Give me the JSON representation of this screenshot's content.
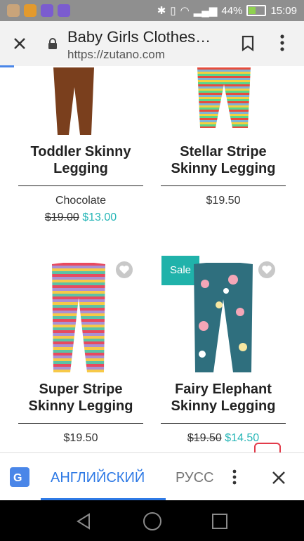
{
  "status_bar": {
    "battery": "44%",
    "time": "15:09",
    "battery_level": 0.44
  },
  "browser": {
    "title": "Baby Girls Clothes…",
    "url": "https://zutano.com",
    "icons": [
      "close-icon",
      "lock-icon",
      "bookmark-icon",
      "more-vert-icon"
    ]
  },
  "products": [
    {
      "name_line1": "Toddler Skinny",
      "name_line2": "Legging",
      "variant": "Chocolate",
      "old_price": "$19.00",
      "price": "$13.00"
    },
    {
      "name_line1": "Stellar Stripe",
      "name_line2": "Skinny Legging",
      "price": "$19.50"
    },
    {
      "name_line1": "Super Stripe",
      "name_line2": "Skinny Legging",
      "price": "$19.50"
    },
    {
      "badge": "Sale",
      "name_line1": "Fairy Elephant",
      "name_line2": "Skinny Legging",
      "old_price": "$19.50",
      "price": "$14.50"
    }
  ],
  "translate_bar": {
    "language_active": "АНГЛИЙСКИЙ",
    "language_other": "РУСС"
  },
  "colors": {
    "accent": "#26b6b7",
    "translate_blue": "#2f7ae5",
    "status_bar": "#8f8f8f"
  }
}
